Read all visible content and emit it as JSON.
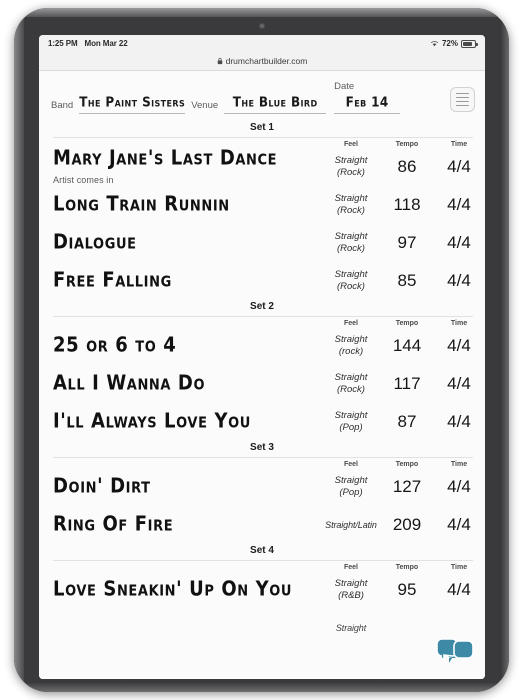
{
  "status_bar": {
    "time": "1:25 PM",
    "date": "Mon Mar 22",
    "battery_percent": "72%",
    "wifi_icon": "wifi-icon",
    "battery_icon": "battery-icon"
  },
  "browser": {
    "url": "drumchartbuilder.com",
    "lock_icon": "lock-icon"
  },
  "chart_header": {
    "band_label": "Band",
    "band_value": "The Paint Sisters",
    "venue_label": "Venue",
    "venue_value": "The Blue Bird",
    "date_label": "Date",
    "date_value": "Feb 14",
    "menu_icon": "hamburger-menu-icon"
  },
  "columns": {
    "feel": "Feel",
    "tempo": "Tempo",
    "time": "Time"
  },
  "sets": [
    {
      "title": "Set 1",
      "songs": [
        {
          "title": "Mary Jane's Last Dance",
          "feel_main": "Straight",
          "feel_sub": "(Rock)",
          "tempo": "86",
          "time": "4/4",
          "note": "Artist comes in"
        },
        {
          "title": "Long Train Runnin",
          "feel_main": "Straight",
          "feel_sub": "(Rock)",
          "tempo": "118",
          "time": "4/4",
          "note": ""
        },
        {
          "title": "Dialogue",
          "feel_main": "Straight",
          "feel_sub": "(Rock)",
          "tempo": "97",
          "time": "4/4",
          "note": ""
        },
        {
          "title": "Free Falling",
          "feel_main": "Straight",
          "feel_sub": "(Rock)",
          "tempo": "85",
          "time": "4/4",
          "note": ""
        }
      ]
    },
    {
      "title": "Set 2",
      "songs": [
        {
          "title": "25 or 6 to 4",
          "feel_main": "Straight",
          "feel_sub": "(rock)",
          "tempo": "144",
          "time": "4/4",
          "note": ""
        },
        {
          "title": "All I Wanna Do",
          "feel_main": "Straight",
          "feel_sub": "(Rock)",
          "tempo": "117",
          "time": "4/4",
          "note": ""
        },
        {
          "title": "I'll Always Love You",
          "feel_main": "Straight",
          "feel_sub": "(Pop)",
          "tempo": "87",
          "time": "4/4",
          "note": ""
        }
      ]
    },
    {
      "title": "Set 3",
      "songs": [
        {
          "title": "Doin' Dirt",
          "feel_main": "Straight",
          "feel_sub": "(Pop)",
          "tempo": "127",
          "time": "4/4",
          "note": ""
        },
        {
          "title": "Ring Of Fire",
          "feel_main": "Straight/Latin",
          "feel_sub": "",
          "tempo": "209",
          "time": "4/4",
          "note": ""
        }
      ]
    },
    {
      "title": "Set 4",
      "songs": [
        {
          "title": "Love Sneakin' Up On You",
          "feel_main": "Straight",
          "feel_sub": "(R&B)",
          "tempo": "95",
          "time": "4/4",
          "note": ""
        },
        {
          "title": "",
          "feel_main": "Straight",
          "feel_sub": "",
          "tempo": "",
          "time": "",
          "note": ""
        }
      ]
    }
  ],
  "chat_widget": {
    "icon": "chat-bubbles-icon",
    "color": "#3c8aa6"
  }
}
